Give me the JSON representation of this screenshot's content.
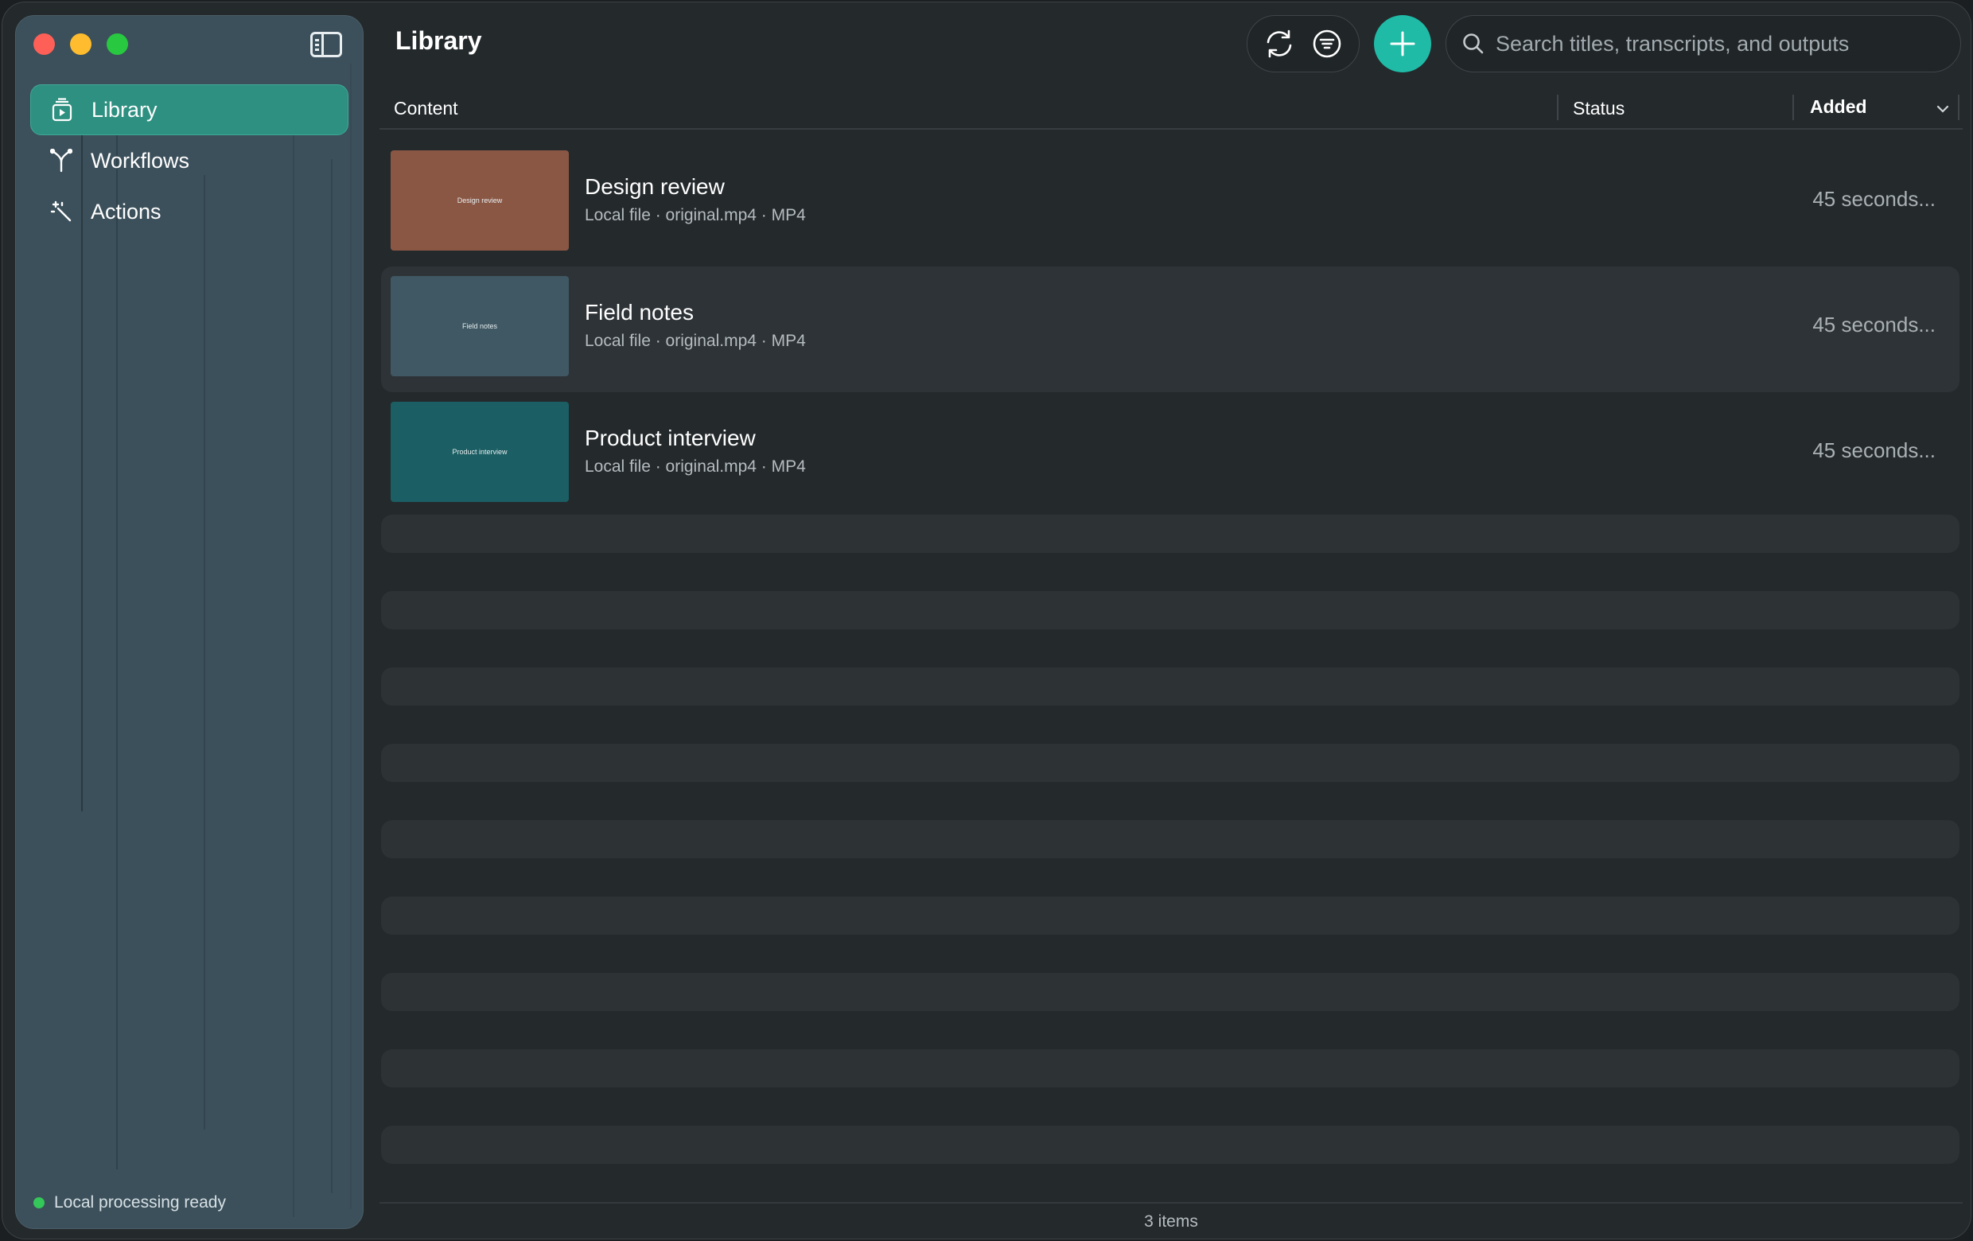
{
  "sidebar": {
    "items": [
      {
        "label": "Library",
        "icon": "library-icon",
        "active": true
      },
      {
        "label": "Workflows",
        "icon": "workflows-icon",
        "active": false
      },
      {
        "label": "Actions",
        "icon": "actions-icon",
        "active": false
      }
    ],
    "status": "Local processing ready"
  },
  "header": {
    "title": "Library",
    "search_placeholder": "Search titles, transcripts, and outputs"
  },
  "table": {
    "columns": {
      "content": "Content",
      "status": "Status",
      "added": "Added"
    },
    "rows": [
      {
        "thumb_label": "Design review",
        "title": "Design review",
        "meta": "Local file · original.mp4 · MP4",
        "status": "",
        "added": "45 seconds...",
        "thumb_color": "#8b5745"
      },
      {
        "thumb_label": "Field notes",
        "title": "Field notes",
        "meta": "Local file · original.mp4 · MP4",
        "status": "",
        "added": "45 seconds...",
        "thumb_color": "#3f5863"
      },
      {
        "thumb_label": "Product interview",
        "title": "Product interview",
        "meta": "Local file · original.mp4 · MP4",
        "status": "",
        "added": "45 seconds...",
        "thumb_color": "#1b5e63"
      }
    ]
  },
  "footer": {
    "count": "3 items"
  },
  "colors": {
    "accent": "#1fbba6",
    "sidebar_active": "#2e9080",
    "ready": "#34c759"
  }
}
